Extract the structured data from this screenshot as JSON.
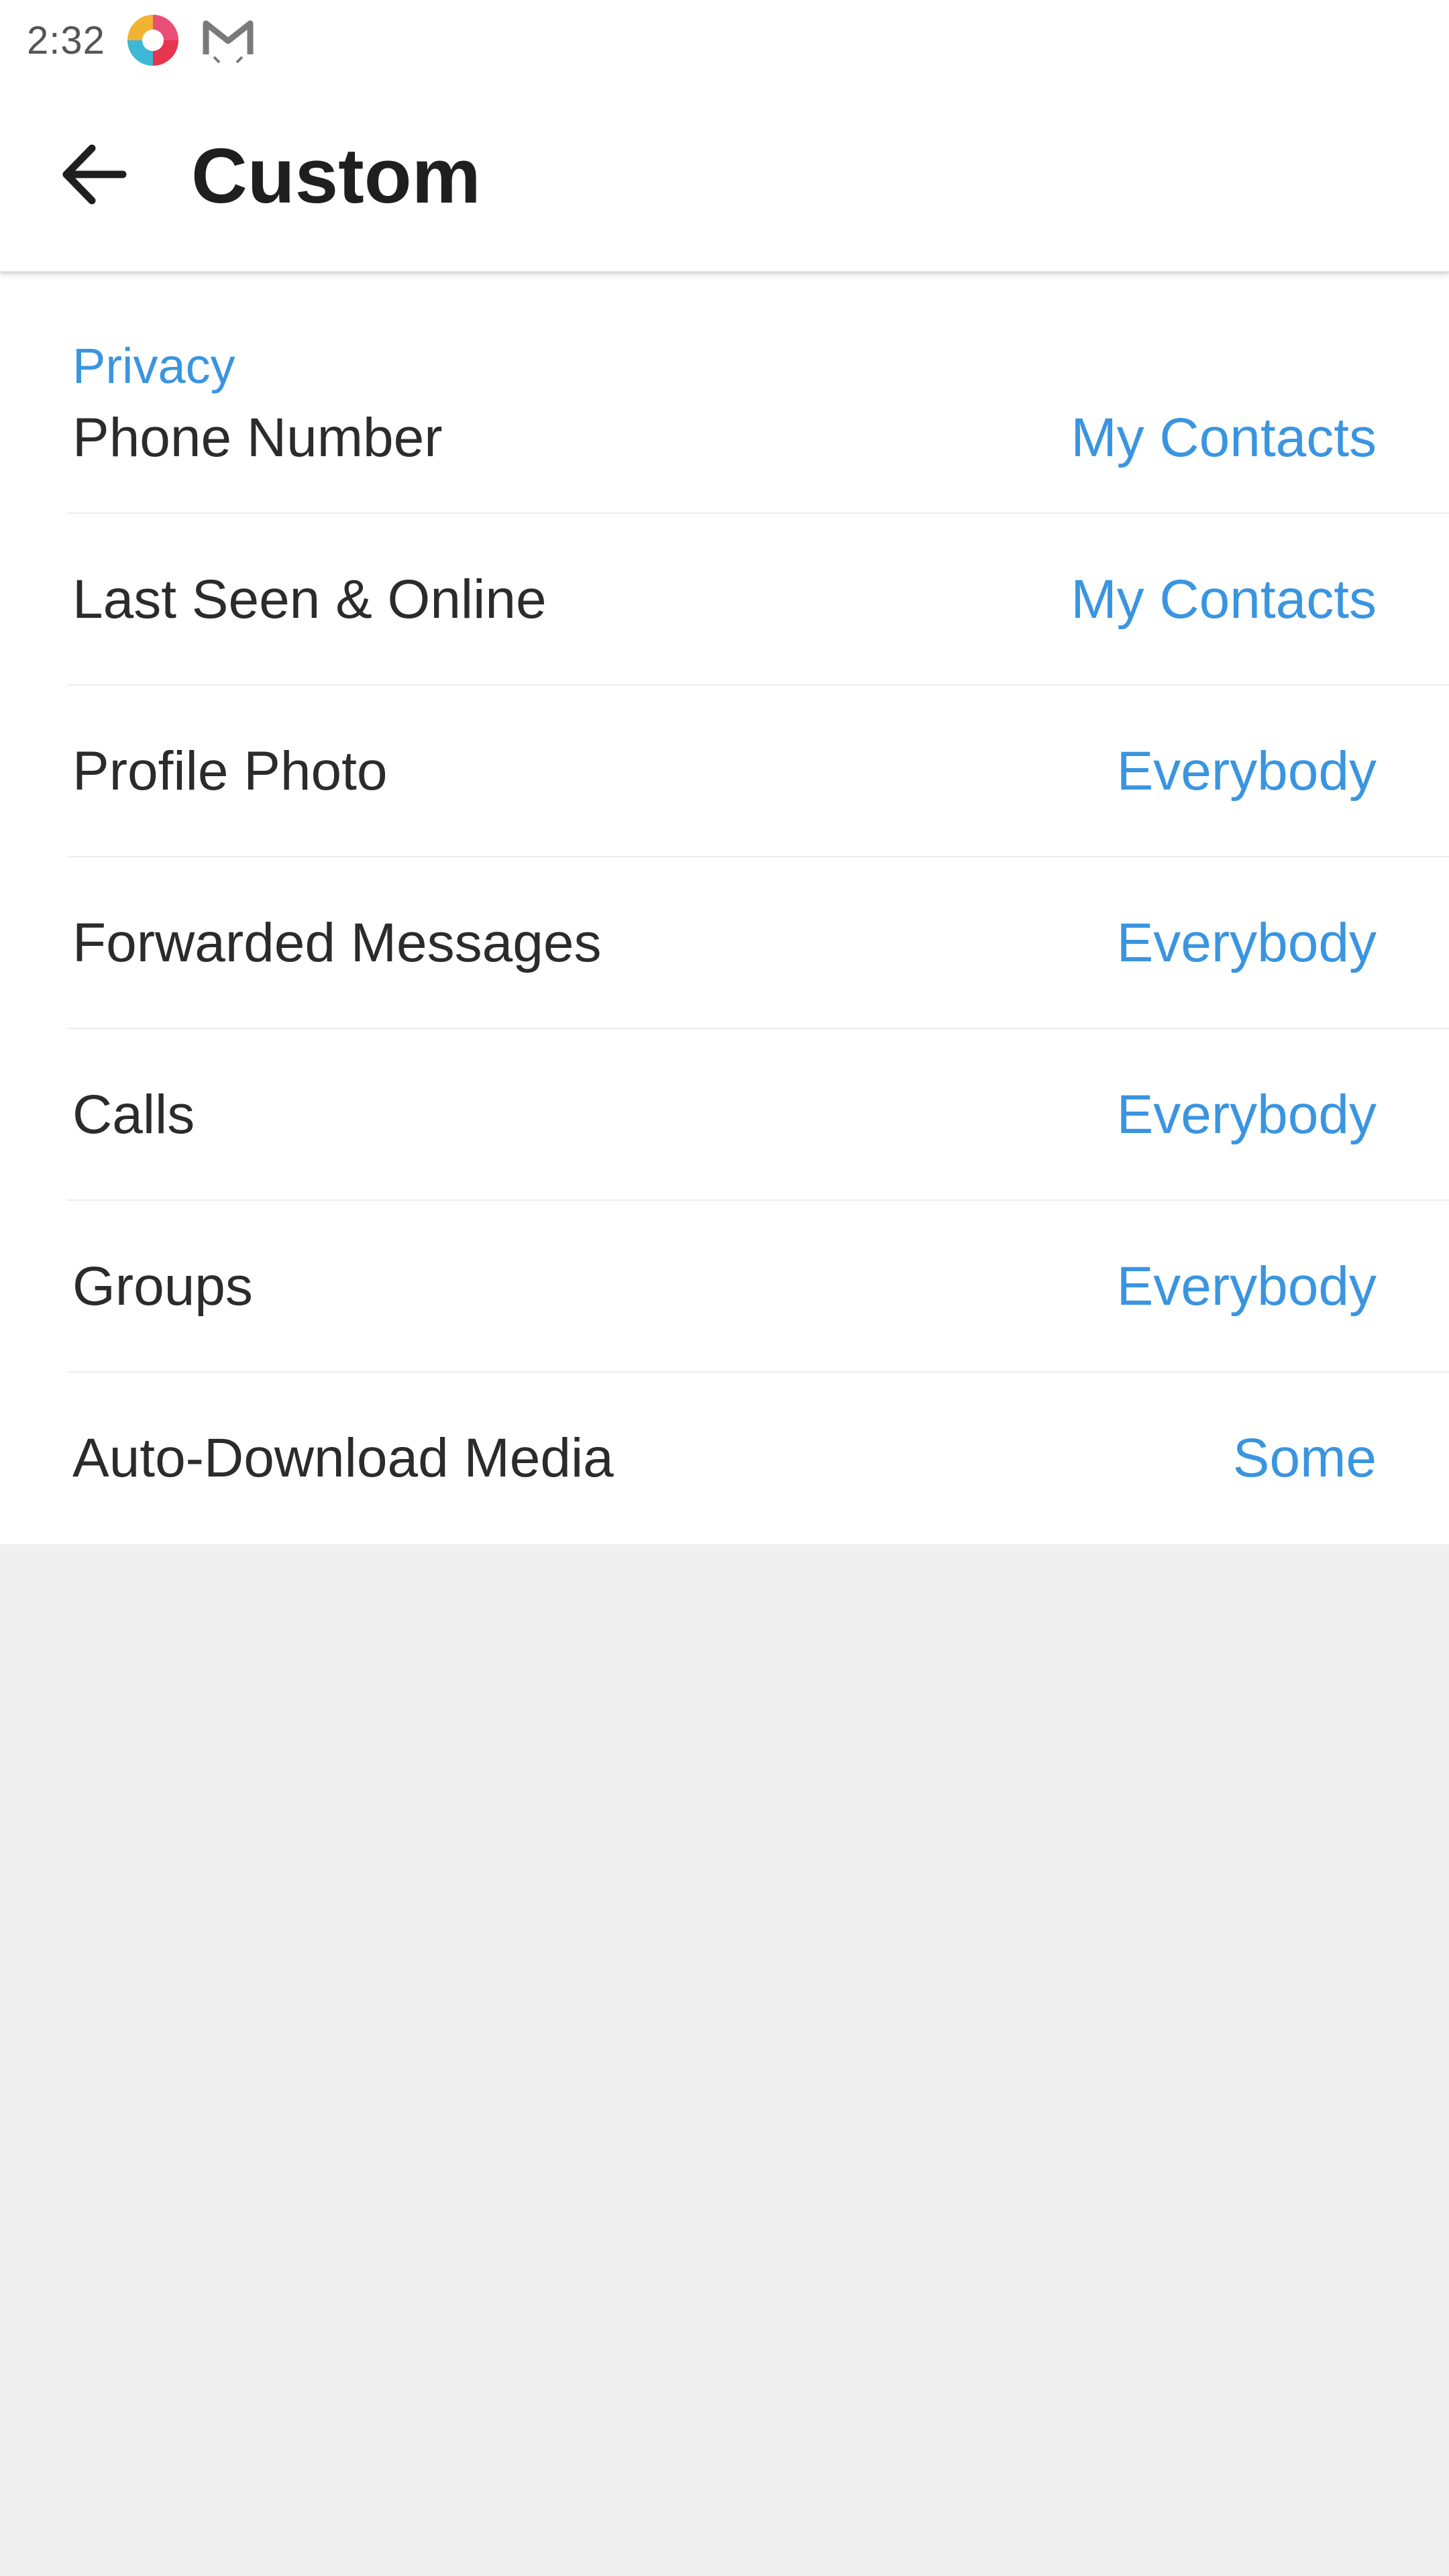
{
  "status_bar": {
    "time": "2:32",
    "icons": [
      "browser-app-icon",
      "mail-app-icon"
    ]
  },
  "app_bar": {
    "back_icon": "arrow-left-icon",
    "title": "Custom"
  },
  "section": {
    "header": "Privacy"
  },
  "rows": [
    {
      "label": "Phone Number",
      "value": "My Contacts"
    },
    {
      "label": "Last Seen & Online",
      "value": "My Contacts"
    },
    {
      "label": "Profile Photo",
      "value": "Everybody"
    },
    {
      "label": "Forwarded Messages",
      "value": "Everybody"
    },
    {
      "label": "Calls",
      "value": "Everybody"
    },
    {
      "label": "Groups",
      "value": "Everybody"
    },
    {
      "label": "Auto-Download Media",
      "value": "Some"
    }
  ],
  "colors": {
    "accent": "#3a95e0",
    "text": "#2b2b2b",
    "background": "#efefef"
  }
}
